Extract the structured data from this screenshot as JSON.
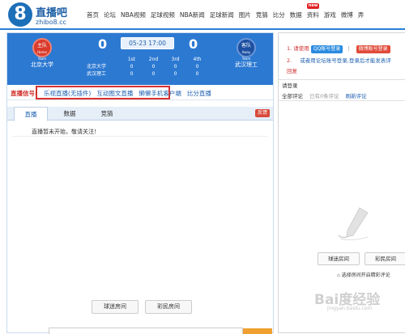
{
  "logo": {
    "mark": "8",
    "cn": "直播吧",
    "en": "zhibo8.cc"
  },
  "nav": [
    {
      "label": "首页"
    },
    {
      "label": "论坛"
    },
    {
      "label": "NBA视频"
    },
    {
      "label": "足球视频"
    },
    {
      "label": "NBA新闻"
    },
    {
      "label": "足球新闻"
    },
    {
      "label": "图片"
    },
    {
      "label": "竞猜"
    },
    {
      "label": "比分"
    },
    {
      "label": "数据"
    },
    {
      "label": "资料",
      "badge": "new"
    },
    {
      "label": "游戏"
    },
    {
      "label": "微博"
    },
    {
      "label": "弄"
    }
  ],
  "match": {
    "home": {
      "badge_main": "主队",
      "badge_sub": "Home Team",
      "name": "北京大学",
      "score": "0"
    },
    "away": {
      "badge_main": "客队",
      "badge_sub": "Away Team",
      "name": "武汉理工",
      "score": "0"
    },
    "time": "05-23 17:00",
    "quarters": {
      "headers": [
        "1st",
        "2nd",
        "3rd",
        "4th"
      ],
      "rows": [
        {
          "team": "北京大学",
          "values": [
            "0",
            "0",
            "0",
            "0"
          ]
        },
        {
          "team": "武汉理工",
          "values": [
            "0",
            "0",
            "0",
            "0"
          ]
        }
      ]
    }
  },
  "signal": {
    "title": "直播信号:",
    "links": [
      "乐视直播(无插件)",
      "互动图文直播",
      "懒懒手机客户端",
      "比分直播"
    ]
  },
  "tabs": [
    "直播",
    "数据",
    "竞猜"
  ],
  "feedback": "反馈",
  "notice": "直播暂未开始，敬请关注！",
  "bottom_buttons": [
    "球迷房间",
    "彩民房间"
  ],
  "right": {
    "login_num1": "1.",
    "login_prefix": "请使用",
    "qq_login": "QQ账号登录",
    "sep": "|",
    "weibo_login": "微博账号登录",
    "login_num2": "2.",
    "hint_text": "或者用论坛账号登录,登录后才能发表评",
    "hint_reply": "回复",
    "section_title": "请登录",
    "comment_tabs": [
      "全部评论",
      "已有0条评论",
      "刷新评论"
    ],
    "room_buttons": [
      "球迷房间",
      "彩民房间"
    ],
    "enter_hint": "选择房间开启精彩评论"
  },
  "watermark": {
    "main": "Bai度经验",
    "sub": "jingyan.baidu.com"
  },
  "colors": {
    "accent": "#2c79d2",
    "signal_red": "#d83030",
    "link": "#1c5fb0"
  }
}
